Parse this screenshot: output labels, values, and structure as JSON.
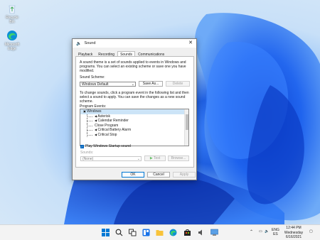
{
  "desktop": {
    "icons": [
      {
        "label": "Recycle Bin"
      },
      {
        "label": "Microsoft Edge"
      }
    ]
  },
  "dialog": {
    "title": "Sound",
    "tabs": [
      "Playback",
      "Recording",
      "Sounds",
      "Communications"
    ],
    "active_tab": "Sounds",
    "intro": "A sound theme is a set of sounds applied to events in Windows and programs.  You can select an existing scheme or save one you have modified.",
    "scheme_label": "Sound Scheme:",
    "scheme_value": "Windows Default",
    "save_as_label": "Save As...",
    "delete_label": "Delete",
    "change_text": "To change sounds, click a program event in the following list and then select a sound to apply.  You can save the changes as a new sound scheme.",
    "events_label": "Program Events:",
    "events": [
      {
        "label": "Windows",
        "level": 0
      },
      {
        "label": "Asterisk",
        "level": 1
      },
      {
        "label": "Calendar Reminder",
        "level": 1
      },
      {
        "label": "Close Program",
        "level": 1
      },
      {
        "label": "Critical Battery Alarm",
        "level": 1
      },
      {
        "label": "Critical Stop",
        "level": 1
      }
    ],
    "startup_label": "Play Windows Startup sound",
    "startup_checked": true,
    "sounds_label": "Sounds:",
    "sounds_value": "(None)",
    "test_label": "Test",
    "browse_label": "Browse...",
    "ok_label": "OK",
    "cancel_label": "Cancel",
    "apply_label": "Apply"
  },
  "taskbar": {
    "tray": {
      "lang1": "ENG",
      "lang2": "ES",
      "time": "12:44 PM",
      "day": "Wednesday",
      "date": "6/16/2021"
    }
  }
}
